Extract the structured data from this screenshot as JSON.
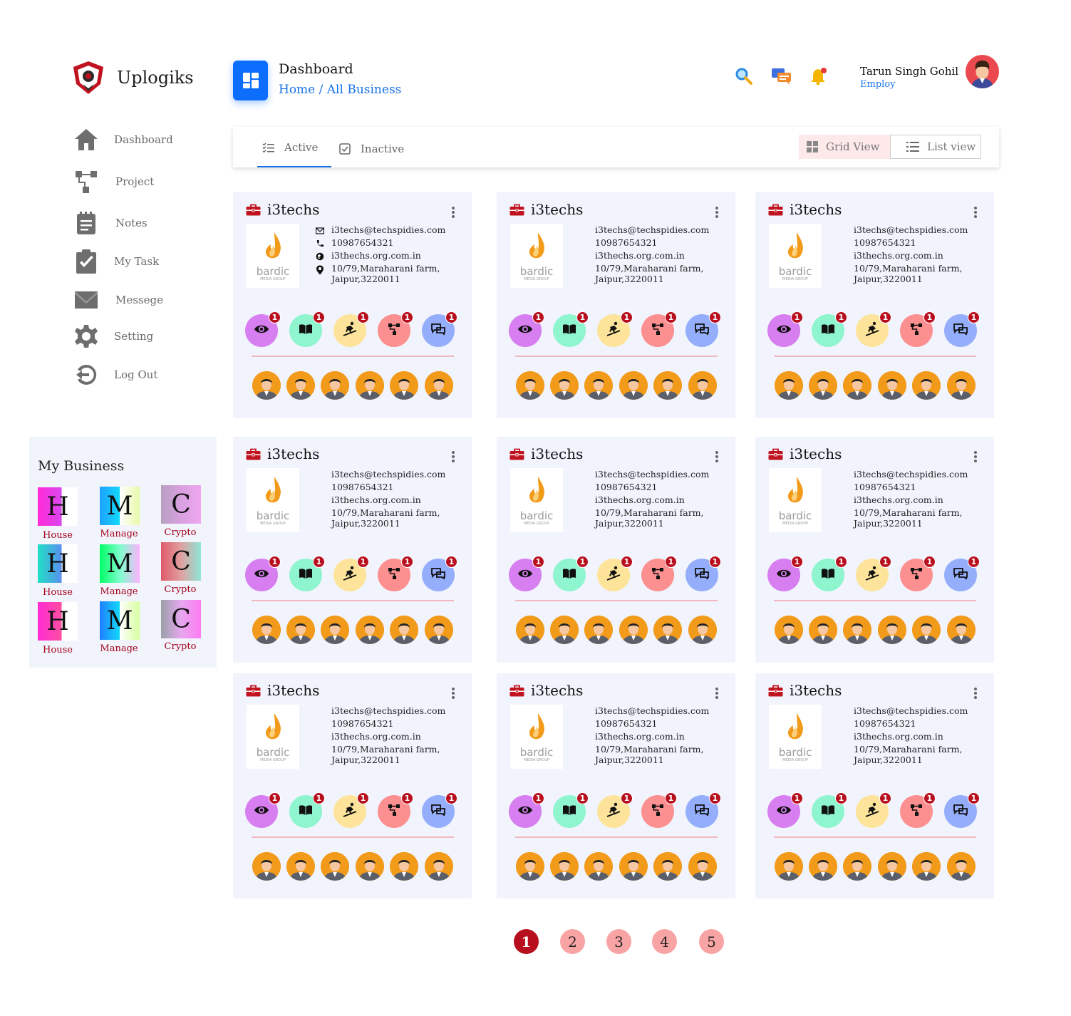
{
  "app": {
    "name": "Uplogiks"
  },
  "sidebar": {
    "items": [
      {
        "label": "Dashboard",
        "icon": "home-icon"
      },
      {
        "label": "Project",
        "icon": "project-icon"
      },
      {
        "label": "Notes",
        "icon": "notes-icon"
      },
      {
        "label": "My Task",
        "icon": "task-icon"
      },
      {
        "label": "Messege",
        "icon": "mail-icon"
      },
      {
        "label": "Setting",
        "icon": "gear-icon"
      },
      {
        "label": "Log Out",
        "icon": "logout-icon"
      }
    ]
  },
  "my_business": {
    "title": "My Business",
    "tiles": [
      {
        "letter": "H",
        "label": "House"
      },
      {
        "letter": "M",
        "label": "Manage"
      },
      {
        "letter": "C",
        "label": "Crypto"
      },
      {
        "letter": "H",
        "label": "House"
      },
      {
        "letter": "M",
        "label": "Manage"
      },
      {
        "letter": "C",
        "label": "Crypto"
      },
      {
        "letter": "H",
        "label": "House"
      },
      {
        "letter": "M",
        "label": "Manage"
      },
      {
        "letter": "C",
        "label": "Crypto"
      }
    ]
  },
  "header": {
    "title": "Dashboard",
    "breadcrumb": "Home / All Business",
    "icons": [
      "search-icon",
      "chat-icon",
      "bell-icon"
    ],
    "user": {
      "name": "Tarun Singh Gohil",
      "role": "Employ"
    }
  },
  "tabs": {
    "active": "Active",
    "inactive": "Inactive",
    "grid_view": "Grid View",
    "list_view": "List view"
  },
  "cards": [
    {
      "title": "i3techs",
      "logo_text": "bardic",
      "logo_sub": "MEDIA GROUP",
      "email": "i3techs@techspidies.com",
      "phone": "10987654321",
      "website": "i3thechs.org.com.in",
      "address_1": "10/79,Maraharani farm,",
      "address_2": "Jaipur,3220011",
      "show_icons": true,
      "counts": [
        1,
        1,
        1,
        1,
        1
      ]
    },
    {
      "title": "i3techs",
      "logo_text": "bardic",
      "logo_sub": "MEDIA GROUP",
      "email": "i3techs@techspidies.com",
      "phone": "10987654321",
      "website": "i3thechs.org.com.in",
      "address_1": "10/79,Maraharani farm,",
      "address_2": "Jaipur,3220011",
      "show_icons": false,
      "counts": [
        1,
        1,
        1,
        1,
        1
      ]
    },
    {
      "title": "i3techs",
      "logo_text": "bardic",
      "logo_sub": "MEDIA GROUP",
      "email": "i3techs@techspidies.com",
      "phone": "10987654321",
      "website": "i3thechs.org.com.in",
      "address_1": "10/79,Maraharani farm,",
      "address_2": "Jaipur,3220011",
      "show_icons": false,
      "counts": [
        1,
        1,
        1,
        1,
        1
      ]
    },
    {
      "title": "i3techs",
      "logo_text": "bardic",
      "logo_sub": "MEDIA GROUP",
      "email": "i3techs@techspidies.com",
      "phone": "10987654321",
      "website": "i3thechs.org.com.in",
      "address_1": "10/79,Maraharani farm,",
      "address_2": "Jaipur,3220011",
      "show_icons": false,
      "counts": [
        1,
        1,
        1,
        1,
        1
      ]
    },
    {
      "title": "i3techs",
      "logo_text": "bardic",
      "logo_sub": "MEDIA GROUP",
      "email": "i3techs@techspidies.com",
      "phone": "10987654321",
      "website": "i3thechs.org.com.in",
      "address_1": "10/79,Maraharani farm,",
      "address_2": "Jaipur,3220011",
      "show_icons": false,
      "counts": [
        1,
        1,
        1,
        1,
        1
      ]
    },
    {
      "title": "i3techs",
      "logo_text": "bardic",
      "logo_sub": "MEDIA GROUP",
      "email": "i3techs@techspidies.com",
      "phone": "10987654321",
      "website": "i3thechs.org.com.in",
      "address_1": "10/79,Maraharani farm,",
      "address_2": "Jaipur,3220011",
      "show_icons": false,
      "counts": [
        1,
        1,
        1,
        1,
        1
      ]
    },
    {
      "title": "i3techs",
      "logo_text": "bardic",
      "logo_sub": "MEDIA GROUP",
      "email": "i3techs@techspidies.com",
      "phone": "10987654321",
      "website": "i3thechs.org.com.in",
      "address_1": "10/79,Maraharani farm,",
      "address_2": "Jaipur,3220011",
      "show_icons": false,
      "counts": [
        1,
        1,
        1,
        1,
        1
      ]
    },
    {
      "title": "i3techs",
      "logo_text": "bardic",
      "logo_sub": "MEDIA GROUP",
      "email": "i3techs@techspidies.com",
      "phone": "10987654321",
      "website": "i3thechs.org.com.in",
      "address_1": "10/79,Maraharani farm,",
      "address_2": "Jaipur,3220011",
      "show_icons": false,
      "counts": [
        1,
        1,
        1,
        1,
        1
      ]
    },
    {
      "title": "i3techs",
      "logo_text": "bardic",
      "logo_sub": "MEDIA GROUP",
      "email": "i3techs@techspidies.com",
      "phone": "10987654321",
      "website": "i3thechs.org.com.in",
      "address_1": "10/79,Maraharani farm,",
      "address_2": "Jaipur,3220011",
      "show_icons": false,
      "counts": [
        1,
        1,
        1,
        1,
        1
      ]
    }
  ],
  "card_actions": [
    {
      "icon": "eye-icon",
      "color": "#d77ef0"
    },
    {
      "icon": "book-icon",
      "color": "#8ef5cf"
    },
    {
      "icon": "snowboard-icon",
      "color": "#fde49a"
    },
    {
      "icon": "hierarchy-icon",
      "color": "#fc8f8f"
    },
    {
      "icon": "chat-bubbles-icon",
      "color": "#94aefc"
    }
  ],
  "pagination": {
    "pages": [
      "1",
      "2",
      "3",
      "4",
      "5"
    ],
    "current": "1"
  },
  "colors": {
    "accent": "#1a73e8",
    "brand_red": "#b80f1e",
    "card_bg": "#f1f4fd"
  }
}
